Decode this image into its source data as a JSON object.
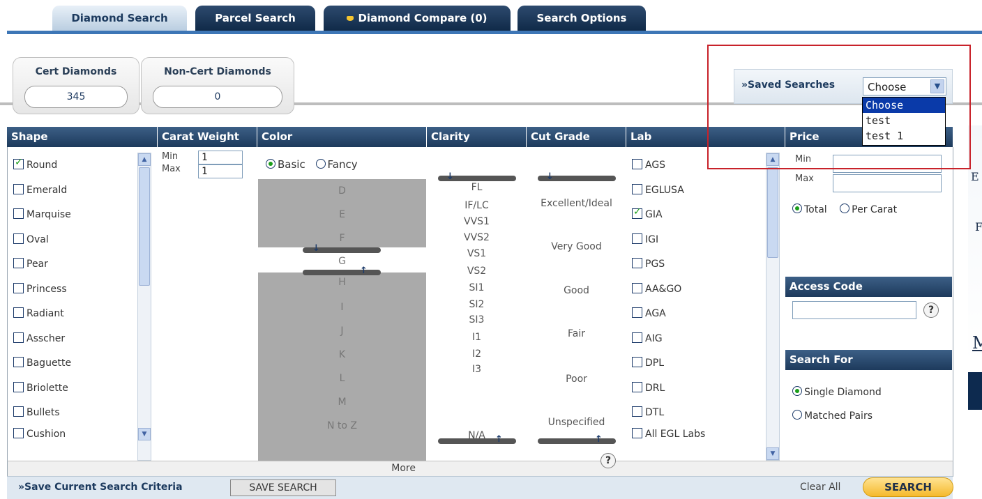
{
  "tabs": [
    {
      "label": "Diamond Search",
      "active": true
    },
    {
      "label": "Parcel Search"
    },
    {
      "label": "Diamond Compare (0)"
    },
    {
      "label": "Search Options"
    }
  ],
  "counts": {
    "cert": {
      "label": "Cert Diamonds",
      "value": "345"
    },
    "noncert": {
      "label": "Non-Cert Diamonds",
      "value": "0"
    }
  },
  "saved_searches": {
    "label": "»Saved Searches",
    "selected": "Choose",
    "options": [
      "Choose",
      "test",
      "test 1"
    ]
  },
  "columns": {
    "shape": "Shape",
    "carat": "Carat Weight",
    "color": "Color",
    "clarity": "Clarity",
    "cut": "Cut Grade",
    "lab": "Lab",
    "price": "Price"
  },
  "shapes": [
    {
      "label": "Round",
      "checked": true
    },
    {
      "label": "Emerald"
    },
    {
      "label": "Marquise"
    },
    {
      "label": "Oval"
    },
    {
      "label": "Pear"
    },
    {
      "label": "Princess"
    },
    {
      "label": "Radiant"
    },
    {
      "label": "Asscher"
    },
    {
      "label": "Baguette"
    },
    {
      "label": "Briolette"
    },
    {
      "label": "Bullets"
    },
    {
      "label": "Cushion"
    }
  ],
  "carat": {
    "min_label": "Min",
    "max_label": "Max",
    "min": "1",
    "max": "1"
  },
  "color": {
    "basic_label": "Basic",
    "fancy_label": "Fancy",
    "grades": [
      "D",
      "E",
      "F",
      "G",
      "H",
      "I",
      "J",
      "K",
      "L",
      "M",
      "N to Z"
    ],
    "more_label": "More"
  },
  "clarity": [
    "FL",
    "IF/LC",
    "VVS1",
    "VVS2",
    "VS1",
    "VS2",
    "SI1",
    "SI2",
    "SI3",
    "I1",
    "I2",
    "I3",
    "N/A"
  ],
  "cut": [
    "Excellent/Ideal",
    "Very Good",
    "Good",
    "Fair",
    "Poor",
    "Unspecified"
  ],
  "labs": [
    {
      "label": "AGS"
    },
    {
      "label": "EGLUSA"
    },
    {
      "label": "GIA",
      "checked": true
    },
    {
      "label": "IGI"
    },
    {
      "label": "PGS"
    },
    {
      "label": "AA&GO"
    },
    {
      "label": "AGA"
    },
    {
      "label": "AIG"
    },
    {
      "label": "DPL"
    },
    {
      "label": "DRL"
    },
    {
      "label": "DTL"
    },
    {
      "label": "All EGL Labs"
    }
  ],
  "price": {
    "min_label": "Min",
    "max_label": "Max",
    "total_label": "Total",
    "per_carat_label": "Per Carat"
  },
  "access_code": {
    "title": "Access Code"
  },
  "search_for": {
    "title": "Search For",
    "single": "Single Diamond",
    "pairs": "Matched Pairs"
  },
  "help_glyph": "?",
  "bottom": {
    "save_criteria_label": "»Save Current Search Criteria",
    "save_button": "SAVE SEARCH",
    "clear_all": "Clear All",
    "search_button": "SEARCH"
  },
  "right_edge_fragments": [
    "E",
    "F",
    "M"
  ]
}
